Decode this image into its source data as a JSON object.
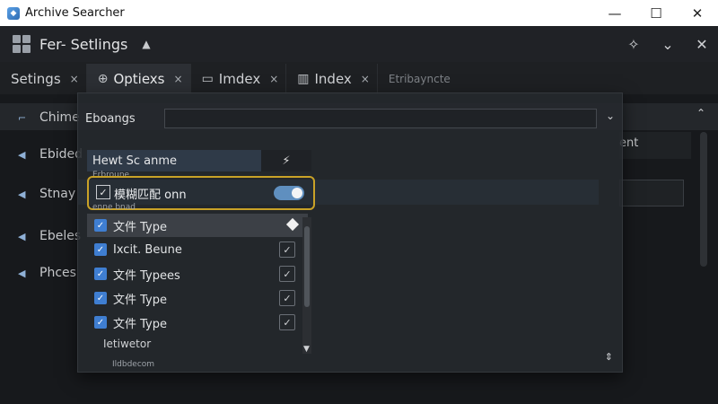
{
  "window": {
    "title": "Archive Searcher",
    "minimize": "—",
    "maximize": "☐",
    "close": "✕"
  },
  "header": {
    "title": "Fer- Setlings",
    "caret": "▲",
    "tools": [
      "✧",
      "⌄",
      "✕"
    ]
  },
  "tabs": [
    {
      "label": "Setings",
      "close": "×"
    },
    {
      "label": "Optiexs",
      "close": "×",
      "icon": "⊕"
    },
    {
      "label": "Imdex",
      "close": "×",
      "icon": "▭"
    },
    {
      "label": "Index",
      "close": "×",
      "icon": "▥"
    },
    {
      "label": "Etribayncte"
    }
  ],
  "background_rows": [
    {
      "arrow": "⌐",
      "label": "Chime"
    },
    {
      "arrow": "◀",
      "label": "Ebided"
    },
    {
      "arrow": "◀",
      "label": "Stnay"
    },
    {
      "arrow": "◀",
      "label": "Ebeles"
    },
    {
      "arrow": "◀",
      "label": "Phces"
    }
  ],
  "background_right_label": "ent",
  "popup": {
    "head_label": "Eboangs",
    "head_chevron": "⌄",
    "field_label": "Hewt Sc anme",
    "field_button": "⚡",
    "field_caption": "Erbroune",
    "fuzzy_label": "模糊匹配 onn",
    "fuzzy_caption": "enne bnad",
    "list": [
      {
        "label": "文件 Type",
        "selected": true
      },
      {
        "label": "Ixcit. Beune",
        "selected": false
      },
      {
        "label": "文件 Typees",
        "selected": false
      },
      {
        "label": "文件 Type",
        "selected": false
      },
      {
        "label": "文件 Type",
        "selected": false
      }
    ],
    "footer_label": "Ietiwetor",
    "footer_caption": "Ildbdecom"
  },
  "colors": {
    "accent": "#3f7ed1",
    "highlight_border": "#c9a227",
    "toggle_on": "#5f8fbf"
  }
}
